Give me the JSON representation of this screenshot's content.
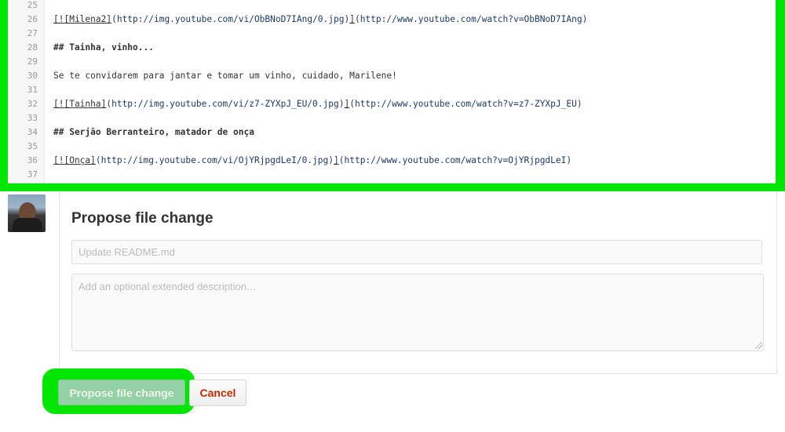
{
  "editor": {
    "lines": [
      {
        "num": "25",
        "text": ""
      },
      {
        "num": "26",
        "alt": "[![Milena2]",
        "img": "(http://img.youtube.com/vi/ObBNoD7IAng/0.jpg)",
        "close": "]",
        "link": "(http://www.youtube.com/watch?v=ObBNoD7IAng)"
      },
      {
        "num": "27",
        "text": ""
      },
      {
        "num": "28",
        "heading": "## Tainha, vinho..."
      },
      {
        "num": "29",
        "text": ""
      },
      {
        "num": "30",
        "text": "Se te convidarem para jantar e tomar um vinho, cuidado, Marilene!"
      },
      {
        "num": "31",
        "text": ""
      },
      {
        "num": "32",
        "alt": "[![Tainha]",
        "img": "(http://img.youtube.com/vi/z7-ZYXpJ_EU/0.jpg)",
        "close": "]",
        "link": "(http://www.youtube.com/watch?v=z7-ZYXpJ_EU)"
      },
      {
        "num": "33",
        "text": ""
      },
      {
        "num": "34",
        "heading": "## Serjão Berranteiro, matador de onça"
      },
      {
        "num": "35",
        "text": ""
      },
      {
        "num": "36",
        "alt": "[![Onça]",
        "img": "(http://img.youtube.com/vi/OjYRjpgdLeI/0.jpg)",
        "close": "]",
        "link": "(http://www.youtube.com/watch?v=OjYRjpgdLeI)"
      },
      {
        "num": "37",
        "text": ""
      }
    ]
  },
  "commit": {
    "title": "Propose file change",
    "summary_placeholder": "Update README.md",
    "description_placeholder": "Add an optional extended description…",
    "submit_label": "Propose file change",
    "cancel_label": "Cancel"
  },
  "colors": {
    "highlight": "#00e600",
    "primary_button": "#95d1a6",
    "cancel_text": "#bd2c00"
  }
}
